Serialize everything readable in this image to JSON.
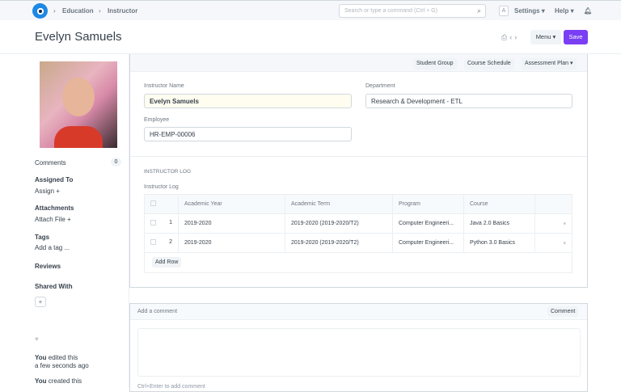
{
  "topbar": {
    "breadcrumbs": [
      "Education",
      "Instructor"
    ],
    "search_placeholder": "Search or type a command (Ctrl + G)",
    "avatar_letter": "A",
    "settings": "Settings",
    "help": "Help"
  },
  "header": {
    "title": "Evelyn Samuels",
    "menu": "Menu",
    "save": "Save"
  },
  "sidebar": {
    "comments": "Comments",
    "comments_count": "0",
    "assigned_to": "Assigned To",
    "assign": "Assign",
    "attachments": "Attachments",
    "attach_file": "Attach File",
    "tags": "Tags",
    "add_tag": "Add a tag ...",
    "reviews": "Reviews",
    "shared_with": "Shared With",
    "activity": [
      {
        "who": "You",
        "what": "edited this",
        "when": "a few seconds ago"
      },
      {
        "who": "You",
        "what": "created this"
      }
    ]
  },
  "toolbar": {
    "buttons": [
      "Student Group",
      "Course Schedule",
      "Assessment Plan"
    ]
  },
  "form": {
    "instructor_name_label": "Instructor Name",
    "instructor_name": "Evelyn Samuels",
    "department_label": "Department",
    "department": "Research & Development - ETL",
    "employee_label": "Employee",
    "employee": "HR-EMP-00006"
  },
  "log": {
    "section": "INSTRUCTOR LOG",
    "label": "Instructor Log",
    "columns": [
      "Academic Year",
      "Academic Term",
      "Program",
      "Course"
    ],
    "rows": [
      {
        "no": "1",
        "year": "2019-2020",
        "term": "2019-2020 (2019-2020/T2)",
        "program": "Computer Engineeri...",
        "course": "Java 2.0 Basics"
      },
      {
        "no": "2",
        "year": "2019-2020",
        "term": "2019-2020 (2019-2020/T2)",
        "program": "Computer Engineeri...",
        "course": "Python 3.0 Basics"
      }
    ],
    "add_row": "Add Row"
  },
  "comment": {
    "placeholder": "Add a comment",
    "button": "Comment",
    "hint": "Ctrl+Enter to add comment"
  },
  "colors": {
    "primary": "#7a3ef5",
    "logo": "#1e88e5"
  }
}
